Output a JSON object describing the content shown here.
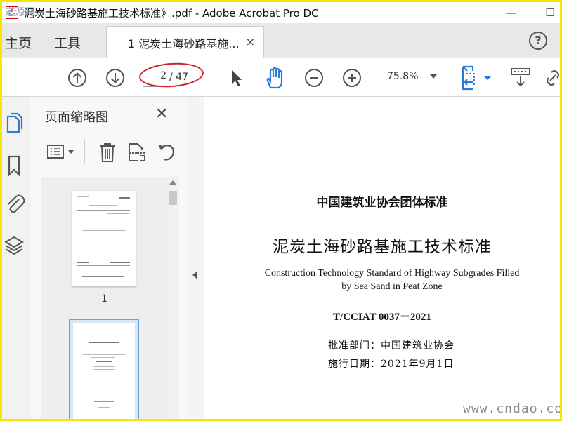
{
  "window": {
    "title": "泥炭土海砂路基施工技术标准》.pdf - Adobe Acrobat Pro DC",
    "minimize": "—",
    "maximize": "☐",
    "watermark_logo": "道源网"
  },
  "menu": {
    "home": "主页",
    "tools": "工具",
    "tab_label": "1 泥炭土海砂路基施...",
    "tab_close": "×",
    "help": "?"
  },
  "toolbar": {
    "page_current": "2",
    "page_total": "/ 47",
    "zoom": "75.8%"
  },
  "panel": {
    "title": "页面缩略图",
    "close": "✕",
    "thumb1_number": "1"
  },
  "document": {
    "org_standard": "中国建筑业协会团体标准",
    "title_cn": "泥炭土海砂路基施工技术标准",
    "title_en_line1": "Construction Technology Standard of Highway Subgrades Filled",
    "title_en_line2": "by Sea Sand in Peat Zone",
    "code": "T/CCIAT 0037－2021",
    "approved_by": "批准部门：中国建筑业协会",
    "effective_date": "施行日期：2021年9月1日"
  },
  "watermark": "www.cndao.com",
  "colors": {
    "frame_yellow": "#f6e700",
    "accent_blue": "#2d7bd6",
    "annotation_red": "#d42020"
  }
}
